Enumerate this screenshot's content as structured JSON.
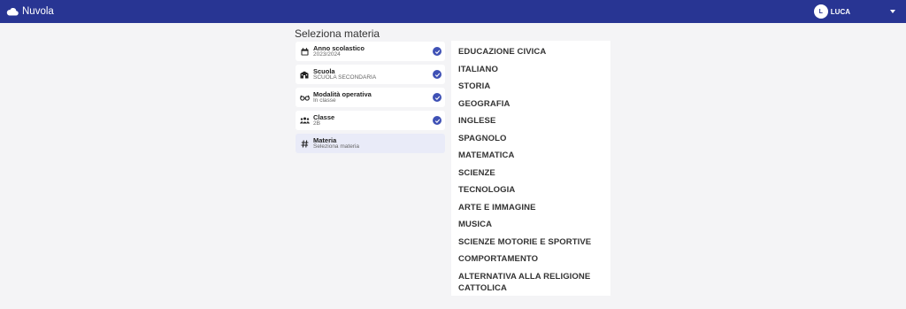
{
  "header": {
    "brand": "Nuvola",
    "user_initial": "L",
    "user_name": "LUCA",
    "color": "#283593"
  },
  "page_title": "Seleziona materia",
  "steps": [
    {
      "label": "Anno scolastico",
      "value": "2023/2024",
      "icon": "calendar-icon",
      "done": true
    },
    {
      "label": "Scuola",
      "value": "SCUOLA SECONDARIA",
      "icon": "school-icon",
      "done": true
    },
    {
      "label": "Modalità operativa",
      "value": "In classe",
      "icon": "glasses-icon",
      "done": true
    },
    {
      "label": "Classe",
      "value": "2B",
      "icon": "group-icon",
      "done": true
    },
    {
      "label": "Materia",
      "value": "Seleziona materia",
      "icon": "hash-icon",
      "done": false
    }
  ],
  "subjects": [
    "EDUCAZIONE CIVICA",
    "ITALIANO",
    "STORIA",
    "GEOGRAFIA",
    "INGLESE",
    "SPAGNOLO",
    "MATEMATICA",
    "SCIENZE",
    "TECNOLOGIA",
    "ARTE E IMMAGINE",
    "MUSICA",
    "SCIENZE MOTORIE E SPORTIVE",
    "COMPORTAMENTO",
    "ALTERNATIVA ALLA RELIGIONE CATTOLICA"
  ]
}
